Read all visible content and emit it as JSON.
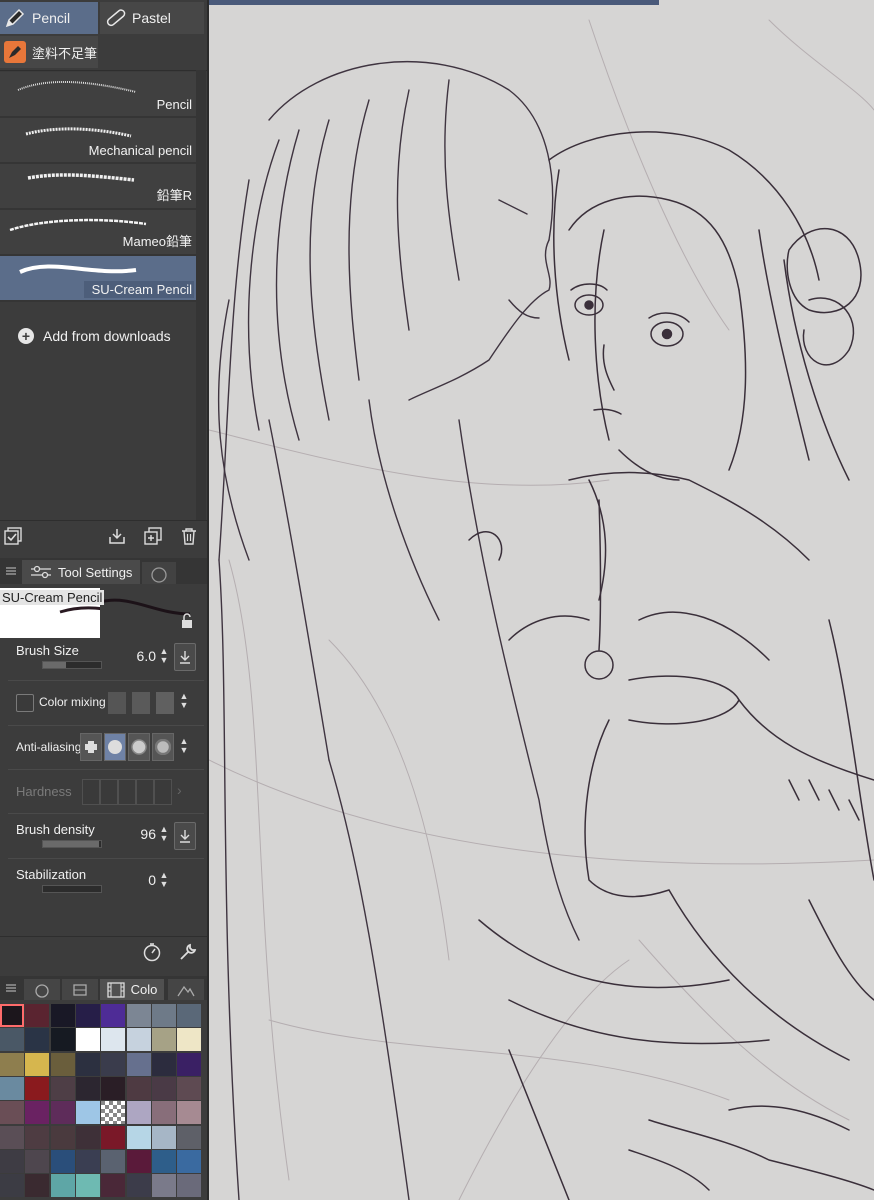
{
  "tool_tabs": {
    "pencil": "Pencil",
    "pastel": "Pastel",
    "sub": "塗料不足筆"
  },
  "brushes": [
    {
      "label": "Pencil"
    },
    {
      "label": "Mechanical pencil"
    },
    {
      "label": "鉛筆R"
    },
    {
      "label": "Mameo鉛筆"
    },
    {
      "label": "SU-Cream Pencil",
      "selected": true
    }
  ],
  "add_from_downloads": "Add from downloads",
  "tool_settings": {
    "tab_label": "Tool Settings",
    "brush_name": "SU-Cream Pencil",
    "brush_size_label": "Brush Size",
    "brush_size_value": "6.0",
    "brush_size_fraction": 0.4,
    "color_mixing_label": "Color mixing",
    "anti_aliasing_label": "Anti-aliasing",
    "hardness_label": "Hardness",
    "brush_density_label": "Brush density",
    "brush_density_value": "96",
    "brush_density_fraction": 0.96,
    "stabilization_label": "Stabilization",
    "stabilization_value": "0",
    "stabilization_fraction": 0.0
  },
  "palette": {
    "tab_label": "Colo",
    "rows": [
      [
        "#1c161c",
        "#5a2430",
        "#191826",
        "#261e48",
        "#4e2c96",
        "#7c8694",
        "#6e7a88",
        "#5a6878"
      ],
      [
        "#4a5866",
        "#2a3446",
        "#161a22",
        "#ffffff",
        "#dde6ee",
        "#c6d2de",
        "#a6a286",
        "#eee6c6"
      ],
      [
        "#8e7e4e",
        "#d6b64e",
        "#6a5e3c",
        "#2c3040",
        "#3a3c4c",
        "#66708e",
        "#2c2c3e",
        "#3a2064"
      ],
      [
        "#6a8aa0",
        "#8a1a1e",
        "#4e3e46",
        "#2c2630",
        "#2a1e26",
        "#4e3a42",
        "#4a3a46",
        "#5e4a52"
      ],
      [
        "#6a4e56",
        "#6a2262",
        "#5e2c5a",
        "#9ec6e6",
        "checker",
        "#ada6c2",
        "#886e7a",
        "#a68a92"
      ],
      [
        "#5a4e56",
        "#4e3c42",
        "#4a3a3e",
        "#3e3038",
        "#7a1828",
        "#b6d6e6",
        "#a6b6c6",
        "#5e6068"
      ],
      [
        "#3e3c44",
        "#4e464e",
        "#2a4e7a",
        "#3a3e52",
        "#5a6270",
        "#5a1a3a",
        "#2e5e8a",
        "#3a6aa0"
      ],
      [
        "#3c3c44",
        "#3a2a30",
        "#5ea6a6",
        "#6ebab2",
        "#4a2838",
        "#3c3c4a",
        "#7a7a8a",
        "#6a6a7a"
      ]
    ]
  },
  "colors": {
    "accent": "#5b6d8a",
    "panel_bg": "#3c3c3c",
    "canvas_bg": "#d6d5d4",
    "sketch_line": "#4a3f48"
  },
  "icons": [
    "pencil-icon",
    "pastel-icon",
    "marker-icon",
    "plus-circle-icon",
    "checkbox-icon",
    "import-icon",
    "duplicate-icon",
    "trash-icon",
    "menu-icon",
    "sliders-icon",
    "lock-icon",
    "download-icon",
    "stopwatch-icon",
    "wrench-icon",
    "film-icon"
  ]
}
